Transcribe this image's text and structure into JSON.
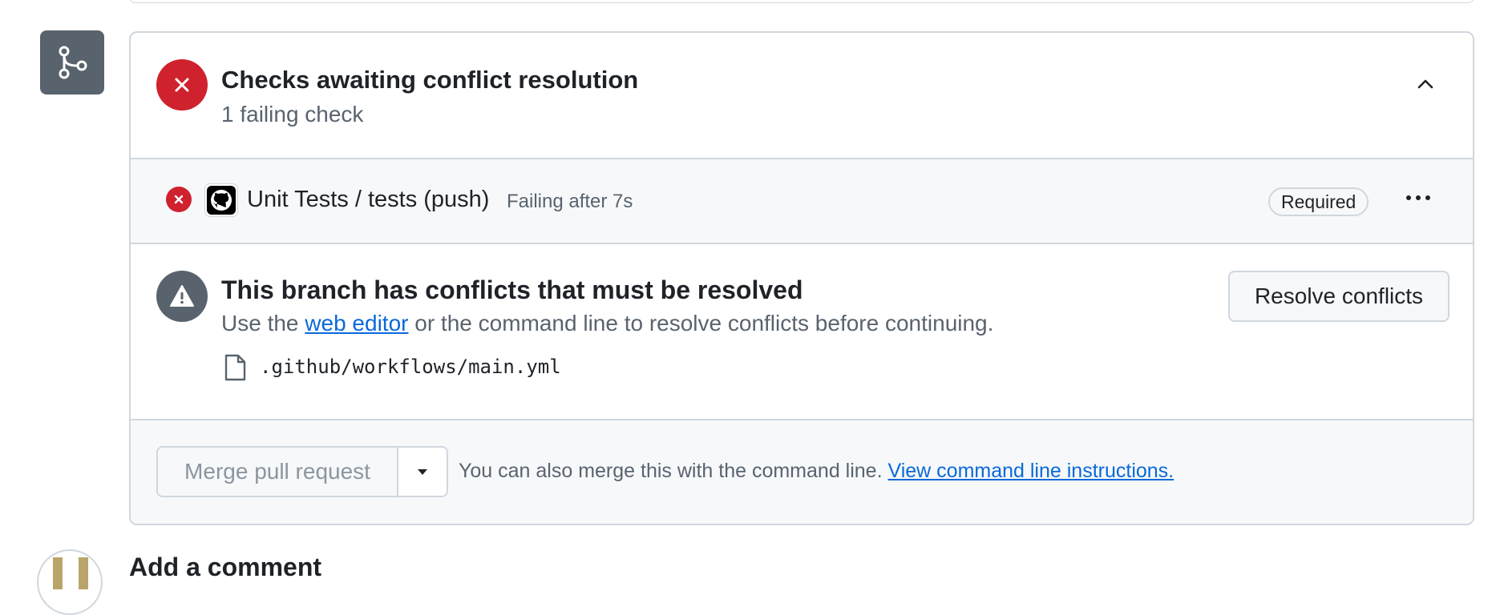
{
  "checks": {
    "title": "Checks awaiting conflict resolution",
    "subtitle": "1 failing check",
    "items": [
      {
        "name": "Unit Tests / tests (push)",
        "status": "Failing after 7s",
        "badge": "Required"
      }
    ]
  },
  "conflicts": {
    "title": "This branch has conflicts that must be resolved",
    "desc_prefix": "Use the ",
    "desc_link": "web editor",
    "desc_suffix": " or the command line to resolve conflicts before continuing.",
    "files": [
      ".github/workflows/main.yml"
    ],
    "resolve_button": "Resolve conflicts"
  },
  "merge": {
    "button_label": "Merge pull request",
    "hint_prefix": "You can also merge this with the command line. ",
    "hint_link": "View command line instructions."
  },
  "comment": {
    "title": "Add a comment"
  },
  "icons": {
    "merge_badge": "git-merge-icon",
    "check_failed": "x-circle-icon",
    "collapse": "chevron-up-icon",
    "check_app": "github-logo-icon",
    "more": "kebab-horizontal-icon",
    "warning": "alert-icon",
    "file": "file-icon",
    "dropdown": "triangle-down-icon"
  },
  "colors": {
    "danger": "#cf222e",
    "neutral_icon_bg": "#59636e",
    "link": "#0969da",
    "border": "#d0d7de",
    "muted_bg": "#f6f8fa"
  }
}
